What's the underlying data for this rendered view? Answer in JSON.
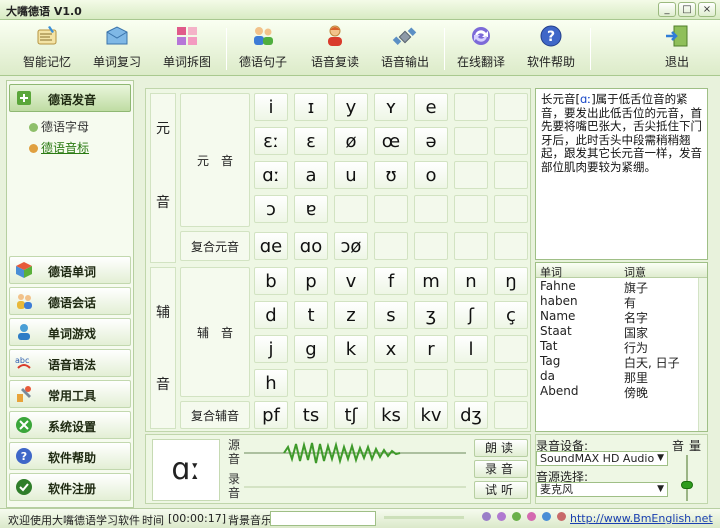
{
  "window": {
    "title": "大嘴德语 V1.0",
    "min": "_",
    "max": "□",
    "close": "×"
  },
  "toolbar": {
    "items": [
      {
        "label": "智能记忆",
        "icon": "book-note-icon"
      },
      {
        "label": "单词复习",
        "icon": "envelope-icon"
      },
      {
        "label": "单词拆图",
        "icon": "grid-image-icon"
      },
      {
        "label": "德语句子",
        "icon": "people-icon"
      },
      {
        "label": "语音复读",
        "icon": "user-speak-icon"
      },
      {
        "label": "语音输出",
        "icon": "satellite-icon"
      },
      {
        "label": "在线翻译",
        "icon": "refresh-globe-icon"
      },
      {
        "label": "软件帮助",
        "icon": "help-icon"
      },
      {
        "label": "退出",
        "icon": "exit-door-icon"
      }
    ]
  },
  "sidebar": {
    "top": {
      "label": "德语发音"
    },
    "subitems": [
      {
        "label": "德语字母"
      },
      {
        "label": "德语音标"
      }
    ],
    "items": [
      {
        "label": "德语单词"
      },
      {
        "label": "德语会话"
      },
      {
        "label": "单词游戏"
      },
      {
        "label": "语音语法"
      },
      {
        "label": "常用工具"
      },
      {
        "label": "系统设置"
      },
      {
        "label": "软件帮助"
      },
      {
        "label": "软件注册"
      }
    ]
  },
  "phonetics": {
    "vowel_section": "元音",
    "vowel_group": "元　音",
    "diphthong_group": "复合元音",
    "consonant_section": "辅音",
    "consonant_group": "辅　音",
    "compound_consonant_group": "复合辅音",
    "vowel_rows": [
      [
        "i",
        "ɪ",
        "y",
        "ʏ",
        "e",
        "",
        ""
      ],
      [
        "ɛː",
        "ɛ",
        "ø",
        "œ",
        "ə",
        "",
        ""
      ],
      [
        "ɑː",
        "a",
        "u",
        "ʊ",
        "o",
        "",
        ""
      ],
      [
        "ɔ",
        "ɐ",
        "",
        "",
        "",
        "",
        ""
      ]
    ],
    "diphthong_row": [
      "ɑe",
      "ɑo",
      "ɔø",
      "",
      "",
      "",
      ""
    ],
    "consonant_rows": [
      [
        "b",
        "p",
        "v",
        "f",
        "m",
        "n",
        "ŋ"
      ],
      [
        "d",
        "t",
        "z",
        "s",
        "ʒ",
        "ʃ",
        "ç"
      ],
      [
        "j",
        "g",
        "k",
        "x",
        "r",
        "l",
        ""
      ],
      [
        "h",
        "",
        "",
        "",
        "",
        "",
        ""
      ]
    ],
    "compound_consonant_row": [
      "pf",
      "ts",
      "tʃ",
      "ks",
      "kv",
      "dʒ",
      ""
    ]
  },
  "player": {
    "symbol": "ɑː",
    "source_label": "源音",
    "record_label": "录音",
    "buttons": {
      "read": "朗读",
      "record": "录音",
      "listen": "试听"
    }
  },
  "description": {
    "prefix": "长元音[",
    "symbol": "ɑː",
    "body": "]属于低舌位音的紧音，要发出此低舌位的元音，首先要将嘴巴张大，舌尖抵住下门牙后，此时舌头中段需稍稍翘起，跟发其它长元音一样，发音部位肌肉要较为紧绷。"
  },
  "wordtable": {
    "headers": [
      "单词",
      "词意"
    ],
    "rows": [
      [
        "Fahne",
        "旗子"
      ],
      [
        "haben",
        "有"
      ],
      [
        "Name",
        "名字"
      ],
      [
        "Staat",
        "国家"
      ],
      [
        "Tat",
        "行为"
      ],
      [
        "Tag",
        "白天, 日子"
      ],
      [
        "da",
        "那里"
      ],
      [
        "Abend",
        "傍晚"
      ]
    ]
  },
  "devices": {
    "record_device_label": "录音设备:",
    "record_device_value": "SoundMAX HD Audio",
    "source_label": "音源选择:",
    "source_value": "麦克风",
    "volume_label": "音量",
    "volume_level": 0.35
  },
  "status": {
    "welcome": "欢迎使用大嘴德语学习软件",
    "time_label": "时间",
    "time_value": "[00:00:17]",
    "music_label": "背景音乐:",
    "link": "http://www.BmEnglish.net",
    "dot_colors": [
      "#9a7fc8",
      "#b07ad0",
      "#6ab04a",
      "#d46ab0",
      "#4a8ed6",
      "#c86a6a"
    ]
  }
}
